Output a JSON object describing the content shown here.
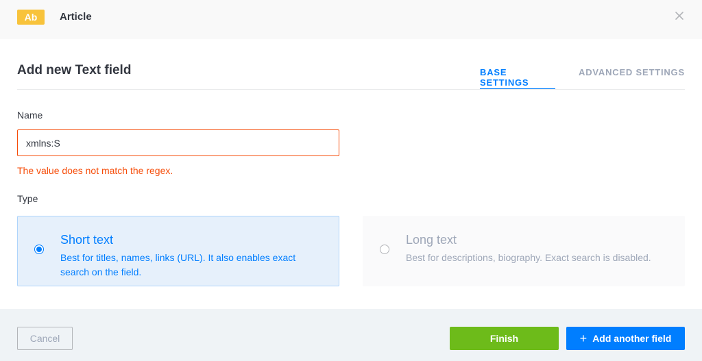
{
  "header": {
    "badge": "Ab",
    "content_type": "Article",
    "close_icon": "close-icon"
  },
  "modal": {
    "title": "Add new Text field",
    "tabs": [
      {
        "label": "BASE SETTINGS",
        "active": true
      },
      {
        "label": "ADVANCED SETTINGS",
        "active": false
      }
    ]
  },
  "form": {
    "name_label": "Name",
    "name_value": "xmlns:S",
    "error": "The value does not match the regex.",
    "type_label": "Type",
    "types": [
      {
        "title": "Short text",
        "description": "Best for titles, names, links (URL). It also enables exact search on the field.",
        "selected": true
      },
      {
        "title": "Long text",
        "description": "Best for descriptions, biography. Exact search is disabled.",
        "selected": false
      }
    ]
  },
  "footer": {
    "cancel": "Cancel",
    "finish": "Finish",
    "add_another": "Add another field",
    "add_icon": "plus-icon"
  },
  "colors": {
    "primary": "#007eff",
    "error": "#f64d0a",
    "success": "#6dbb1a",
    "badge": "#f8c33b"
  }
}
